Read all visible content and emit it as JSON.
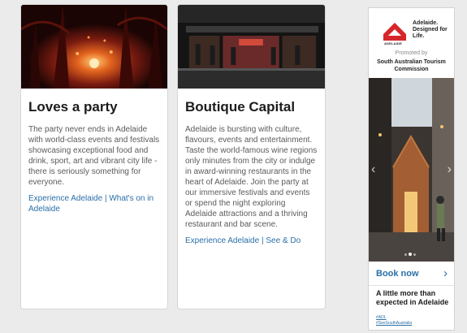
{
  "cards": [
    {
      "title": "Loves a party",
      "text": "The party never ends in Adelaide with world-class events and festivals showcasing exceptional food and drink, sport, art and vibrant city life - there is seriously something for everyone.",
      "link": "Experience Adelaide | What's on in Adelaide"
    },
    {
      "title": "Boutique Capital",
      "text": "Adelaide is bursting with culture, flavours, events and entertainment. Taste the world-famous wine regions only minutes from the city or indulge in award-winning restaurants in the heart of Adelaide. Join the party at our immersive festivals and events or spend the night exploring Adelaide attractions and a thriving restaurant and bar scene.",
      "link": "Experience Adelaide | See & Do"
    }
  ],
  "ad": {
    "logo_word": "ADELAIDE",
    "tagline": "Adelaide. Designed for Life.",
    "promoted_by": "Promoted by",
    "sponsor": "South Australian Tourism Commission",
    "prev_icon": "‹",
    "next_icon": "›",
    "cta_label": "Book now",
    "cta_chevron": "›",
    "headline": "A little more than expected in Adelaide",
    "hashtags": [
      "#ADL",
      "#SeeSouthAustralia"
    ]
  },
  "colors": {
    "link": "#2a6fa8",
    "logo_red": "#d6262c"
  }
}
